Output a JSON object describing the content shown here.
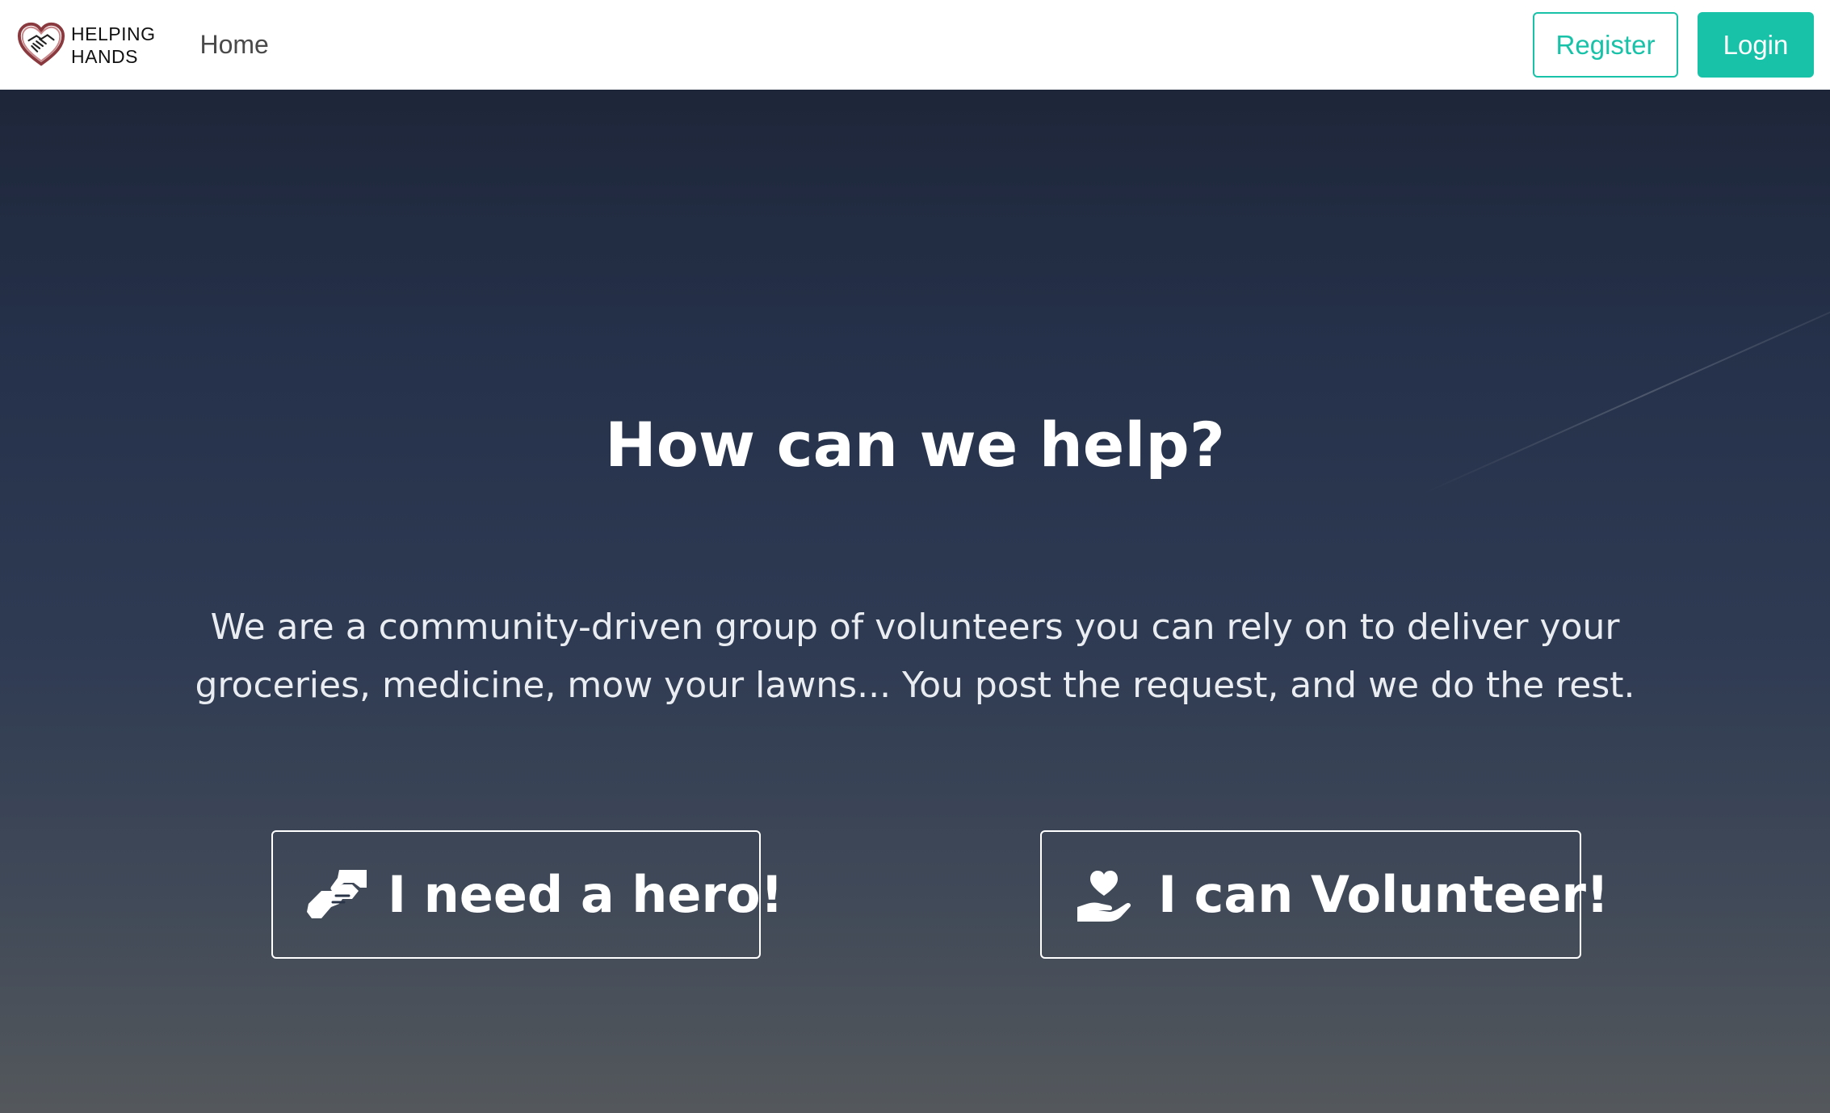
{
  "brand": {
    "line1": "HELPING",
    "line2": "HANDS",
    "logo_icon": "heart-handshake-icon"
  },
  "nav": {
    "home_label": "Home",
    "register_label": "Register",
    "login_label": "Login"
  },
  "hero": {
    "title": "How can we help?",
    "description": "We are a community-driven group of volunteers you can rely on to deliver your groceries, medicine, mow your lawns... You post the request, and we do the rest.",
    "need_hero_label": "I need a hero!",
    "need_hero_icon": "hands-helping-icon",
    "volunteer_label": "I can Volunteer!",
    "volunteer_icon": "hand-holding-heart-icon"
  },
  "colors": {
    "accent": "#17c2a8",
    "navbar_bg": "#ffffff",
    "hero_top": "#1e2639",
    "hero_bottom": "#54585c"
  }
}
